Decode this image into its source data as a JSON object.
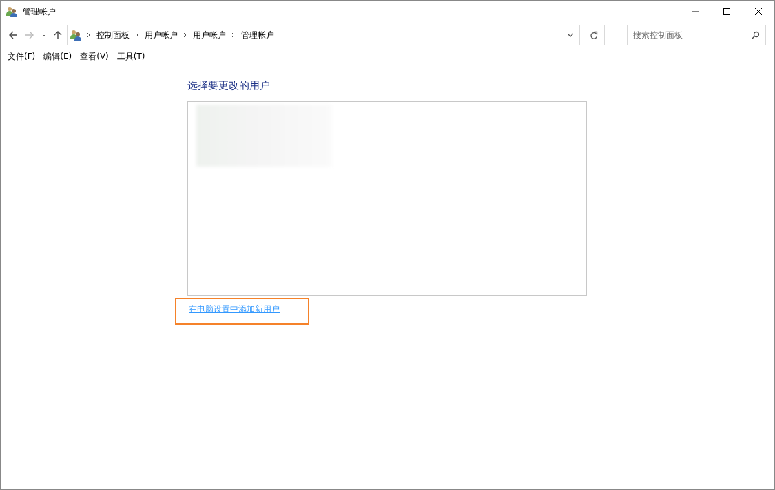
{
  "window": {
    "title": "管理帐户"
  },
  "address_bar": {
    "breadcrumbs": [
      "控制面板",
      "用户帐户",
      "用户帐户",
      "管理帐户"
    ]
  },
  "search": {
    "placeholder": "搜索控制面板"
  },
  "menu": [
    "文件(F)",
    "编辑(E)",
    "查看(V)",
    "工具(T)"
  ],
  "heading": "选择要更改的用户",
  "add_user_link": {
    "label": "在电脑设置中添加新用户",
    "highlighted": true
  }
}
